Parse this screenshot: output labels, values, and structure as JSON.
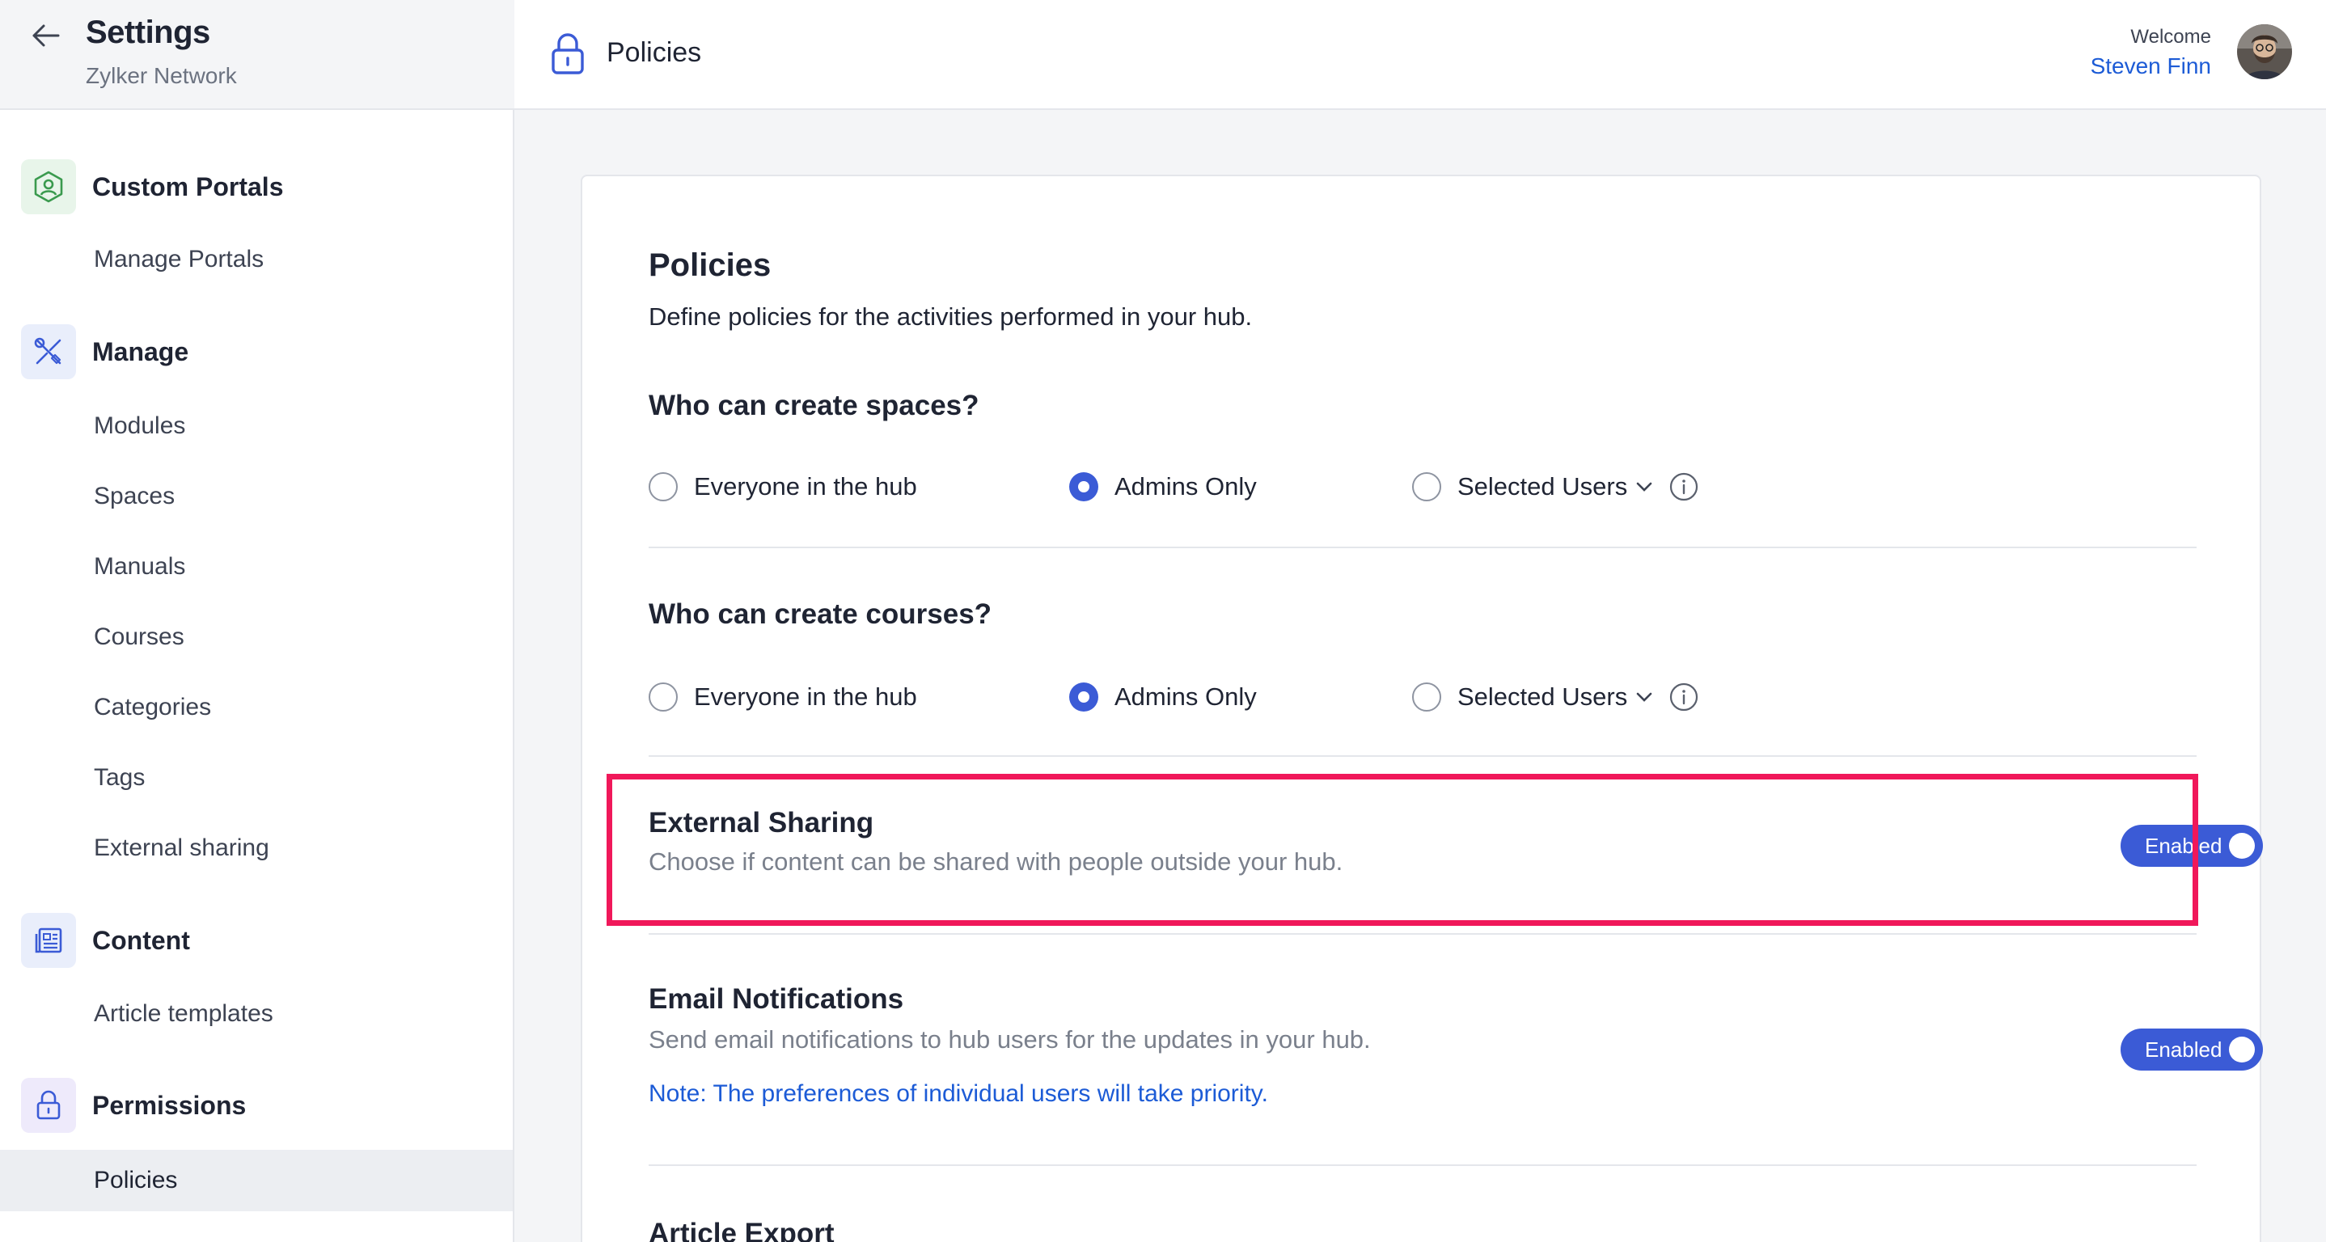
{
  "sidebar": {
    "title": "Settings",
    "subtitle": "Zylker Network",
    "sections": [
      {
        "label": "Custom Portals",
        "icon": "portal-icon",
        "items": [
          "Manage Portals"
        ]
      },
      {
        "label": "Manage",
        "icon": "tools-icon",
        "items": [
          "Modules",
          "Spaces",
          "Manuals",
          "Courses",
          "Categories",
          "Tags",
          "External sharing"
        ]
      },
      {
        "label": "Content",
        "icon": "content-icon",
        "items": [
          "Article templates"
        ]
      },
      {
        "label": "Permissions",
        "icon": "lock-icon",
        "items": [
          "Policies"
        ]
      }
    ],
    "active_item": "Policies"
  },
  "header": {
    "title": "Policies",
    "welcome": "Welcome",
    "user_name": "Steven Finn"
  },
  "main": {
    "title": "Policies",
    "description": "Define policies for the activities performed in your hub.",
    "questions": [
      {
        "title": "Who can create spaces?",
        "options": [
          "Everyone in the hub",
          "Admins Only",
          "Selected Users"
        ],
        "selected": "Admins Only"
      },
      {
        "title": "Who can create courses?",
        "options": [
          "Everyone in the hub",
          "Admins Only",
          "Selected Users"
        ],
        "selected": "Admins Only"
      }
    ],
    "settings": [
      {
        "title": "External Sharing",
        "description": "Choose if content can be shared with people outside your hub.",
        "toggle": "Enabled",
        "highlighted": true
      },
      {
        "title": "Email Notifications",
        "description": "Send email notifications to hub users for the updates in your hub.",
        "note": "Note: The preferences of individual users will take priority.",
        "toggle": "Enabled"
      },
      {
        "title": "Article Export"
      }
    ]
  },
  "colors": {
    "accent": "#3b5bd6",
    "link": "#1c5bd6",
    "highlight": "#f0185a",
    "portal_icon_bg": "#e8f5ea",
    "section_icon_bg": "#e9eefb",
    "permissions_icon_bg": "#eeeafb"
  }
}
